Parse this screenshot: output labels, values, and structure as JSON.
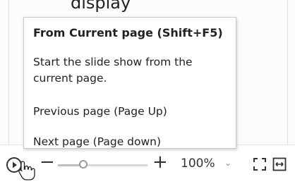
{
  "header": {
    "partial_text": "display"
  },
  "tooltip": {
    "title": "From Current page (Shift+F5)",
    "description": "Start the slide show from the current page.",
    "previous": "Previous page (Page Up)",
    "next": "Next page (Page down)"
  },
  "statusbar": {
    "zoom_label": "100%",
    "zoom_level_percent": 100,
    "slider_fraction": 0.28,
    "icons": {
      "play": "play-circle-icon",
      "minus": "minus-icon",
      "plus": "plus-icon",
      "fit": "fit-to-window-icon",
      "fit_width": "fit-width-icon",
      "cursor": "hand-pointer-icon"
    },
    "minus": "−",
    "plus": "+",
    "chevron": "⌄"
  }
}
